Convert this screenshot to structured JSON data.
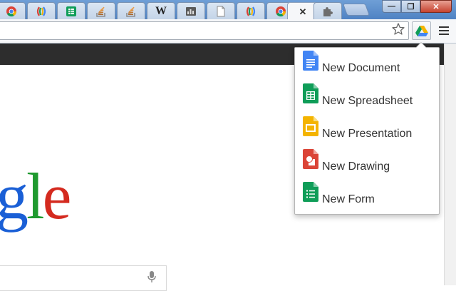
{
  "browser": {
    "tabs": [
      {
        "icon": "chrome-icon"
      },
      {
        "icon": "google-apps-script-icon"
      },
      {
        "icon": "spreadsheet-icon"
      },
      {
        "icon": "stack-overflow-icon"
      },
      {
        "icon": "stack-overflow-icon"
      },
      {
        "icon": "wikipedia-icon",
        "glyph": "W"
      },
      {
        "icon": "blogger-icon"
      },
      {
        "icon": "blank-page-icon"
      },
      {
        "icon": "google-apps-script-icon"
      },
      {
        "icon": "chrome-icon"
      },
      {
        "icon": "active-tab",
        "close_glyph": "✕"
      },
      {
        "icon": "puzzle-extension-icon"
      }
    ],
    "window_buttons": {
      "minimize": "—",
      "maximize": "❐",
      "close": "✕"
    }
  },
  "toolbar": {
    "bookmark_icon": "star-icon",
    "extension_icon": "google-drive-icon",
    "menu_icon": "hamburger-menu-icon"
  },
  "page": {
    "logo_text": "gle",
    "search_icon": "microphone-icon"
  },
  "drive_menu": {
    "items": [
      {
        "label": "New Document",
        "icon": "google-docs-icon",
        "color": "#4285f4"
      },
      {
        "label": "New Spreadsheet",
        "icon": "google-sheets-icon",
        "color": "#0f9d58"
      },
      {
        "label": "New Presentation",
        "icon": "google-slides-icon",
        "color": "#f4b400"
      },
      {
        "label": "New Drawing",
        "icon": "google-drawings-icon",
        "color": "#db4437"
      },
      {
        "label": "New Form",
        "icon": "google-forms-icon",
        "color": "#0f9d58"
      }
    ]
  }
}
